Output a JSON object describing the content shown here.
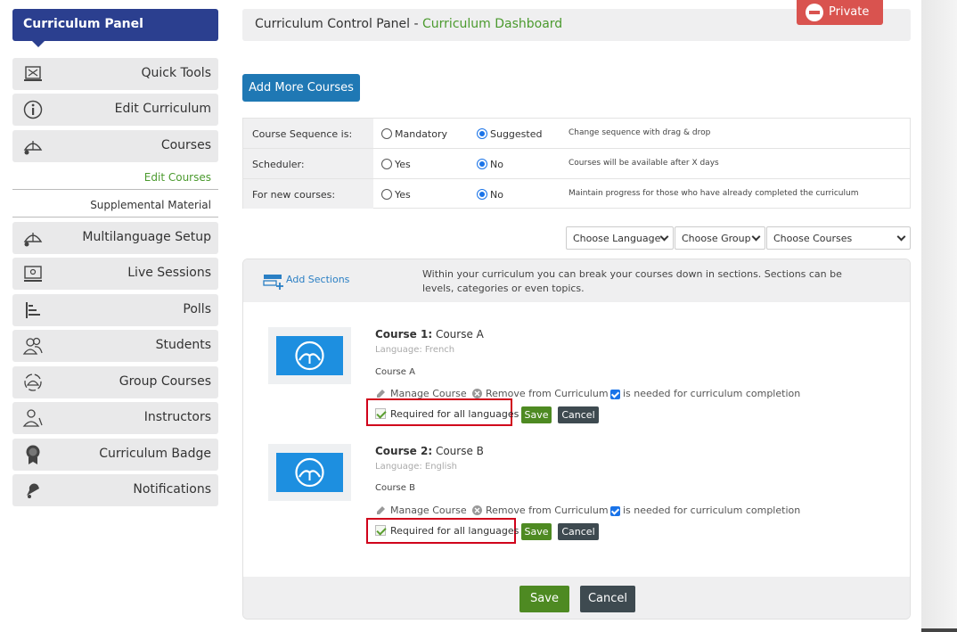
{
  "sidebar": {
    "title": "Curriculum Panel",
    "items": [
      {
        "label": "Quick Tools",
        "icon": "quick-tools-icon"
      },
      {
        "label": "Edit Curriculum",
        "icon": "info-icon"
      },
      {
        "label": "Courses",
        "icon": "courses-icon"
      },
      {
        "label": "Multilanguage Setup",
        "icon": "multilanguage-icon"
      },
      {
        "label": "Live Sessions",
        "icon": "live-sessions-icon"
      },
      {
        "label": "Polls",
        "icon": "polls-icon"
      },
      {
        "label": "Students",
        "icon": "students-icon"
      },
      {
        "label": "Group Courses",
        "icon": "group-courses-icon"
      },
      {
        "label": "Instructors",
        "icon": "instructors-icon"
      },
      {
        "label": "Curriculum Badge",
        "icon": "badge-icon"
      },
      {
        "label": "Notifications",
        "icon": "bell-icon"
      }
    ],
    "sub_items": [
      "Edit Courses",
      "Supplemental Material"
    ]
  },
  "header": {
    "prefix": "Curriculum Control Panel - ",
    "page": "Curriculum Dashboard",
    "private_label": "Private"
  },
  "add_more_label": "Add More Courses",
  "settings": {
    "rows": [
      {
        "label": "Course Sequence is:",
        "opt1": "Mandatory",
        "opt2": "Suggested",
        "selected": "opt2",
        "note": "Change sequence with drag & drop"
      },
      {
        "label": "Scheduler:",
        "opt1": "Yes",
        "opt2": "No",
        "selected": "opt2",
        "note": "Courses will be available after X days"
      },
      {
        "label": "For new courses:",
        "opt1": "Yes",
        "opt2": "No",
        "selected": "opt2",
        "note": "Maintain progress for those who have already completed the curriculum"
      }
    ]
  },
  "filters": {
    "language": "Choose Language",
    "group": "Choose Group",
    "courses": "Choose Courses"
  },
  "sections": {
    "add_label": "Add Sections",
    "description": "Within your curriculum you can break your courses down in sections. Sections can be levels, categories or even topics.",
    "courses": [
      {
        "number": "Course 1:",
        "title": "Course A",
        "language": "Language: French",
        "name": "Course A"
      },
      {
        "number": "Course 2:",
        "title": "Course B",
        "language": "Language: English",
        "name": "Course B"
      }
    ],
    "actions": {
      "manage": "Manage Course",
      "remove": "Remove from Curriculum",
      "needed": "is needed for curriculum completion",
      "required": "Required for all languages",
      "save": "Save",
      "cancel": "Cancel"
    },
    "footer_save": "Save",
    "footer_cancel": "Cancel"
  },
  "colors": {
    "sidebar_title": "#2b3f8f",
    "primary_button": "#1f78b4",
    "save_button": "#4e8a22",
    "cancel_button": "#3e4a50",
    "private_button": "#d9534f",
    "highlight_box": "#d0021b",
    "link_green": "#4b9a2e"
  }
}
